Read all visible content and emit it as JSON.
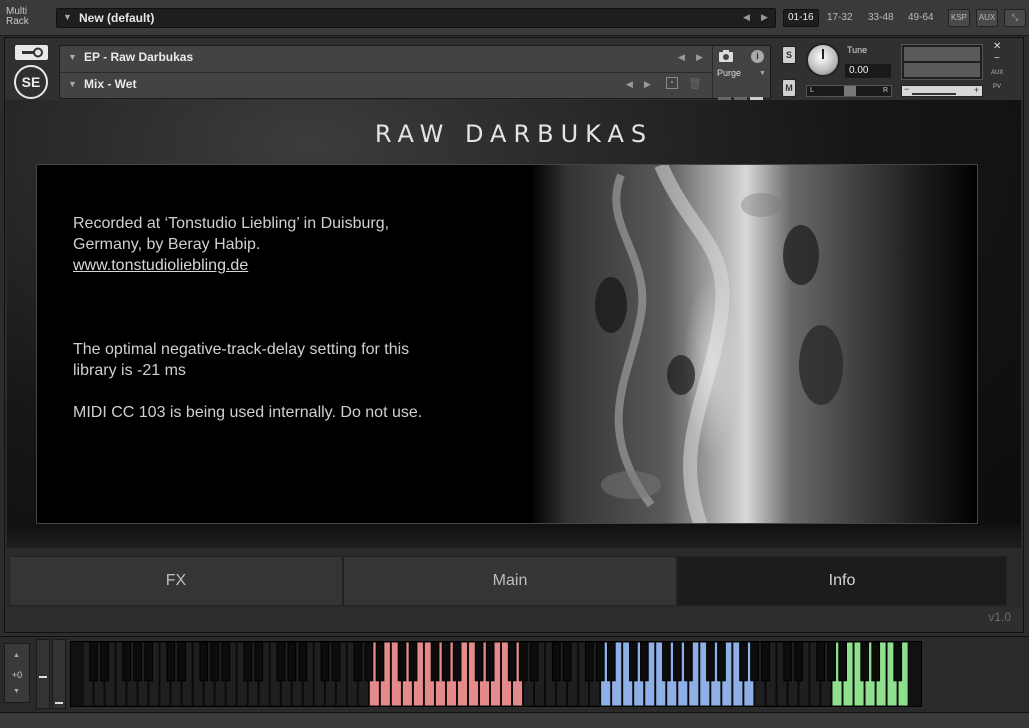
{
  "rack": {
    "label_line1": "Multi",
    "label_line2": "Rack",
    "name": "New (default)",
    "pages": [
      "01-16",
      "17-32",
      "33-48",
      "49-64"
    ],
    "ksp": "KSP",
    "aux": "AUX"
  },
  "header": {
    "instrument_name": "EP - Raw Darbukas",
    "snapshot_name": "Mix - Wet",
    "logo": "SE",
    "purge": "Purge",
    "solo": "S",
    "mute": "M",
    "tune_label": "Tune",
    "tune_value": "0.00",
    "pan_left": "L",
    "pan_right": "R",
    "aux_label": "AUX",
    "pv_label": "PV"
  },
  "panel": {
    "title": "RAW DARBUKAS",
    "line1": "Recorded at ‘Tonstudio Liebling’ in Duisburg,",
    "line2": "Germany, by Beray Habip.",
    "link": "www.tonstudioliebling.de",
    "note1_line1": "The optimal negative-track-delay setting for this",
    "note1_line2": "library is -21 ms",
    "note2": "MIDI CC 103 is being used internally. Do not use."
  },
  "tabs": {
    "fx": "FX",
    "main": "Main",
    "info": "Info",
    "active": "Info"
  },
  "footer": {
    "version": "v1.0"
  },
  "keyboard": {
    "octave_value": "+0",
    "colors": {
      "zone1": "#e48a8a",
      "zone2": "#8fb0e6",
      "zone3": "#8ee08e"
    }
  }
}
